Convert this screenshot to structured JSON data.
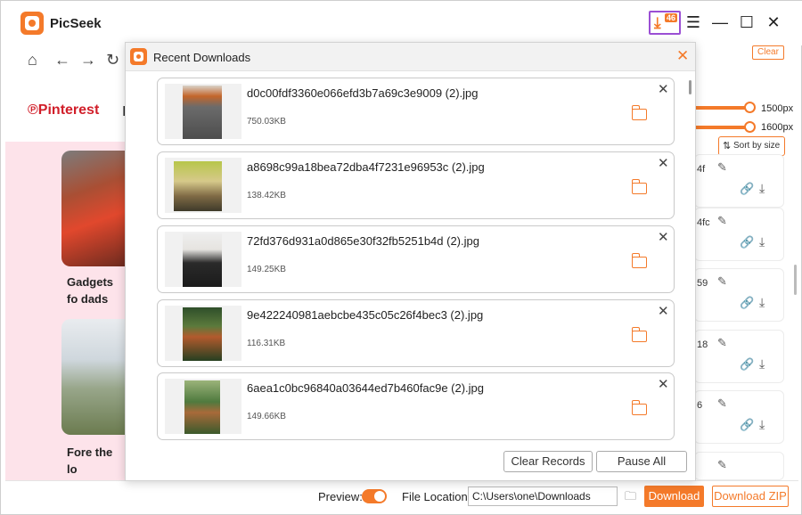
{
  "app": {
    "title": "PicSeek",
    "download_badge": "46"
  },
  "window_controls": {
    "menu": "☰",
    "minimize": "—",
    "maximize": "☐",
    "close": "✕"
  },
  "nav": {
    "home_icon": "home-icon",
    "back_icon": "back-icon",
    "forward_icon": "forward-icon",
    "refresh_icon": "refresh-icon"
  },
  "header": {
    "clear_label": "Clear"
  },
  "left": {
    "site_name": "Pinterest",
    "site_cut": "I",
    "cards": [
      {
        "caption": "Gadgets fo dads"
      },
      {
        "caption": "Fore the lo"
      }
    ]
  },
  "right": {
    "sliders": [
      {
        "value": "1500px"
      },
      {
        "value": "1600px"
      }
    ],
    "sort_label": "Sort by size",
    "cards": [
      {
        "frag": "4f"
      },
      {
        "frag": "4fc"
      },
      {
        "frag": "59"
      },
      {
        "frag": "18"
      },
      {
        "frag": "6"
      },
      {
        "frag": ""
      }
    ]
  },
  "modal": {
    "title": "Recent Downloads",
    "items": [
      {
        "filename": "d0c00fdf3360e066efd3b7a69c3e9009 (2).jpg",
        "size": "750.03KB"
      },
      {
        "filename": "a8698c99a18bea72dba4f7231e96953c (2).jpg",
        "size": "138.42KB"
      },
      {
        "filename": "72fd376d931a0d865e30f32fb5251b4d (2).jpg",
        "size": "149.25KB"
      },
      {
        "filename": "9e422240981aebcbe435c05c26f4bec3 (2).jpg",
        "size": "116.31KB"
      },
      {
        "filename": "6aea1c0bc96840a03644ed7b460fac9e (2).jpg",
        "size": "149.66KB"
      }
    ],
    "clear_records_label": "Clear Records",
    "pause_all_label": "Pause All"
  },
  "bottom": {
    "preview_label": "Preview:",
    "preview_on": true,
    "file_location_label": "File Location",
    "file_location_value": "C:\\Users\\one\\Downloads",
    "download_label": "Download",
    "download_zip_label": "Download ZIP"
  },
  "colors": {
    "accent": "#f47a2a",
    "pinterest": "#d11f2a",
    "badge_border": "#9b4fd4"
  }
}
